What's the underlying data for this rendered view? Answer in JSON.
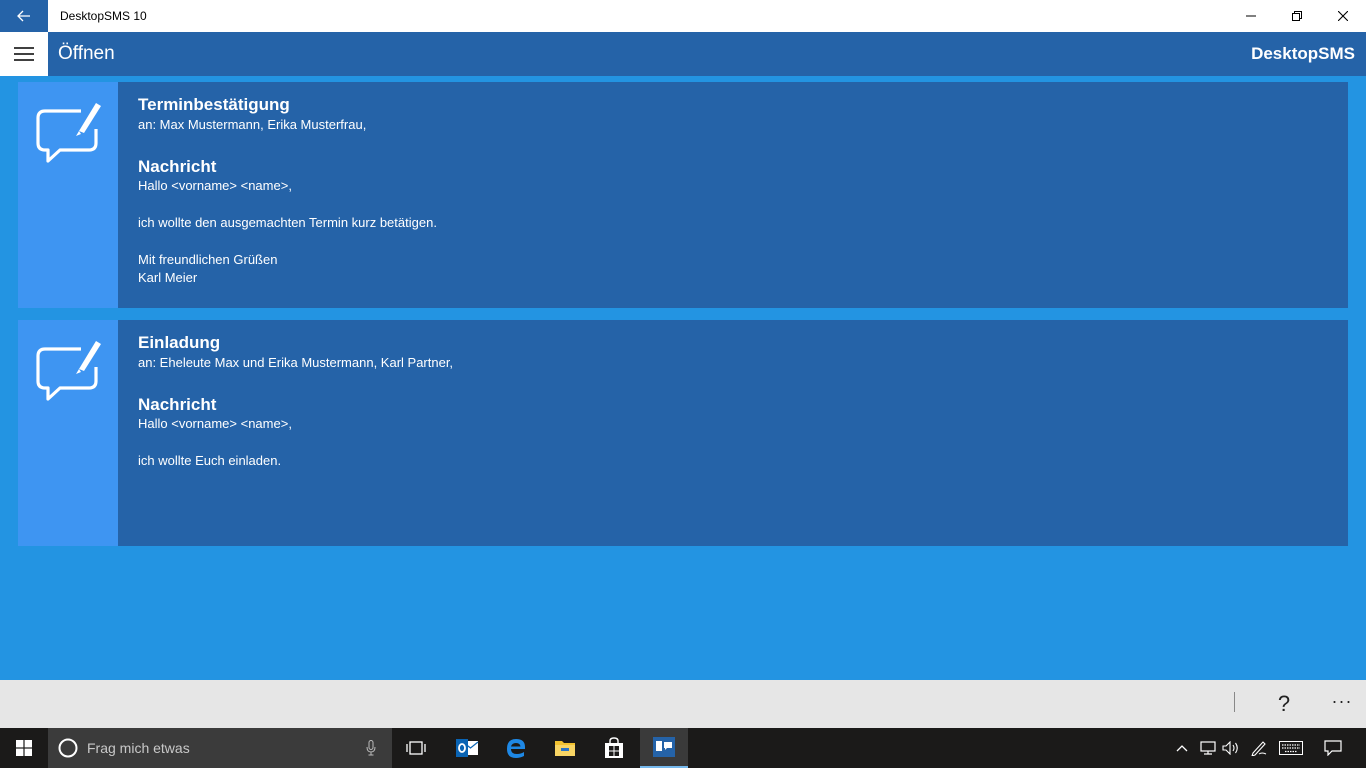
{
  "window": {
    "title": "DesktopSMS 10",
    "minimize_glyph": "—",
    "close_glyph": "✕"
  },
  "appbar": {
    "page_title": "Öffnen",
    "brand": "DesktopSMS"
  },
  "cards": [
    {
      "title": "Terminbestätigung",
      "to": "an: Max Mustermann, Erika Musterfrau,",
      "message_heading": "Nachricht",
      "message_lines": [
        "Hallo <vorname> <name>,",
        "",
        "ich wollte den ausgemachten Termin kurz betätigen.",
        "",
        "Mit freundlichen Grüßen",
        "Karl Meier"
      ]
    },
    {
      "title": "Einladung",
      "to": "an: Eheleute Max und Erika Mustermann, Karl Partner,",
      "message_heading": "Nachricht",
      "message_lines": [
        "Hallo <vorname> <name>,",
        "",
        "ich wollte Euch einladen."
      ]
    }
  ],
  "commandbar": {
    "help": "?",
    "more": "···"
  },
  "taskbar": {
    "search_placeholder": "Frag mich etwas"
  },
  "colors": {
    "accent_dark": "#2563a8",
    "accent_light": "#3e95f2",
    "background": "#2394e2"
  }
}
